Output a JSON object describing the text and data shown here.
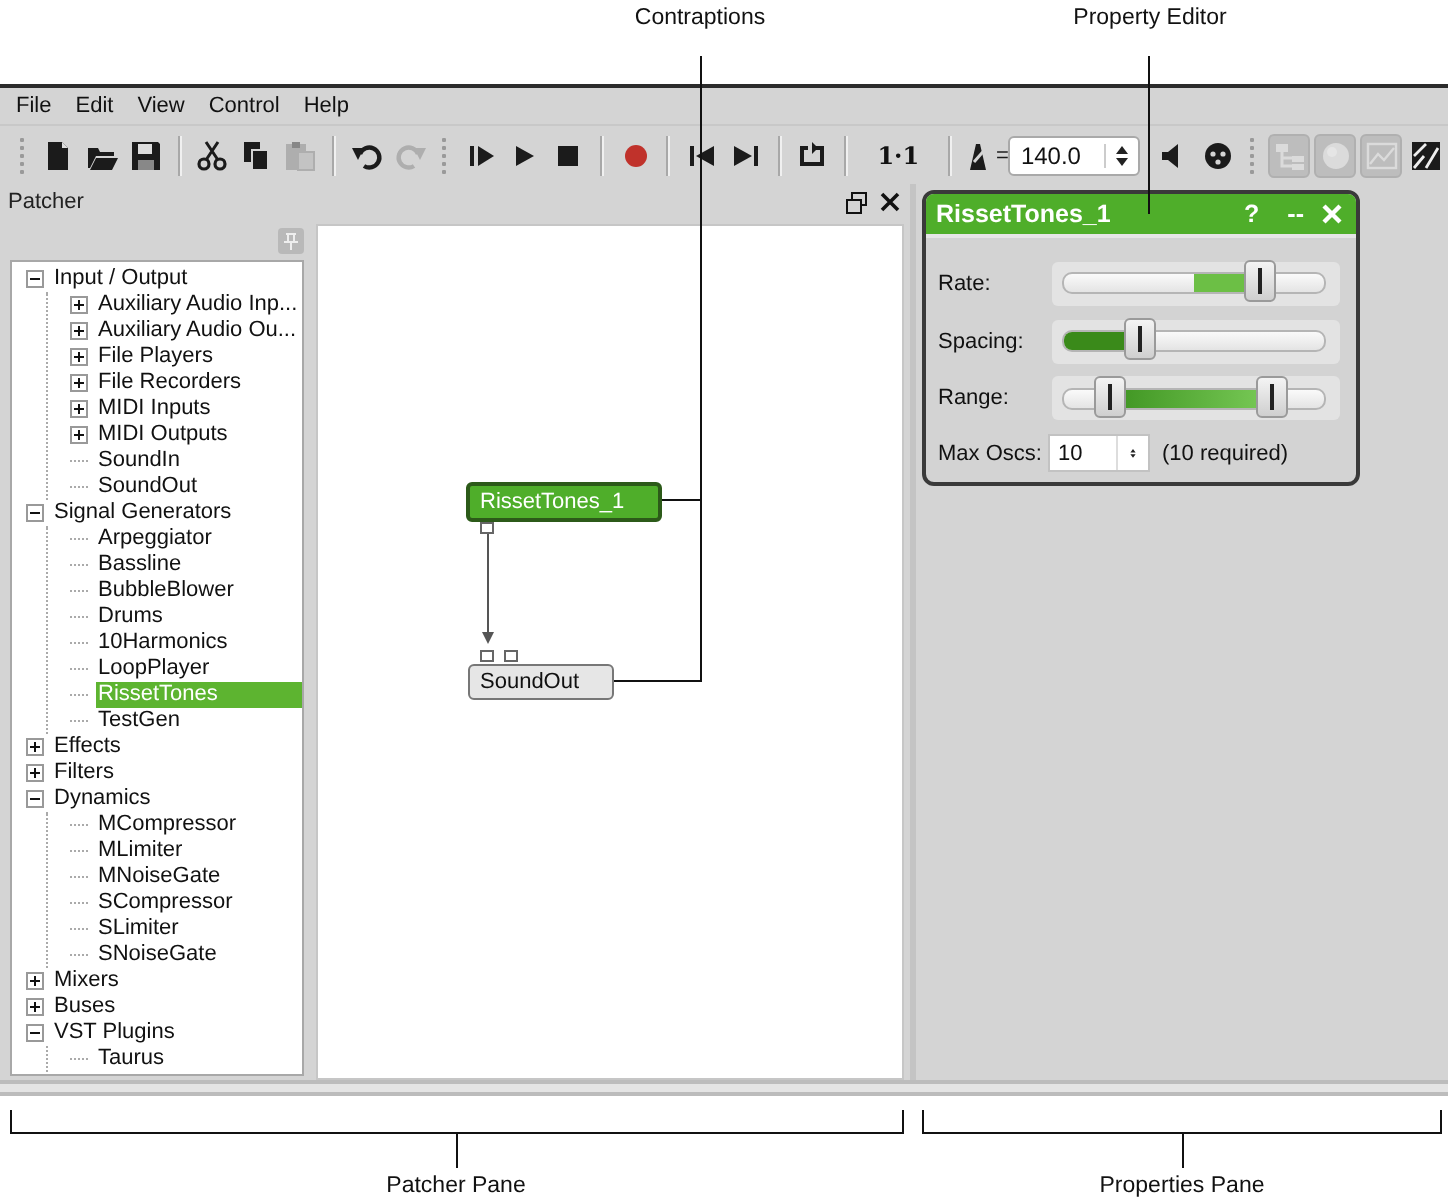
{
  "callouts": {
    "top": [
      {
        "label": "Contraptions"
      },
      {
        "label": "Property Editor"
      }
    ],
    "bottom": [
      {
        "label": "Patcher Pane"
      },
      {
        "label": "Properties Pane"
      }
    ]
  },
  "menu": [
    "File",
    "Edit",
    "View",
    "Control",
    "Help"
  ],
  "toolbar": [
    {
      "kind": "grip"
    },
    {
      "kind": "new-file",
      "disabled": false
    },
    {
      "kind": "open-folder",
      "disabled": false
    },
    {
      "kind": "save",
      "disabled": false
    },
    {
      "kind": "separator"
    },
    {
      "kind": "scissors",
      "disabled": false
    },
    {
      "kind": "copy",
      "disabled": false
    },
    {
      "kind": "paste",
      "disabled": true
    },
    {
      "kind": "separator"
    },
    {
      "kind": "undo",
      "disabled": false
    },
    {
      "kind": "redo",
      "disabled": true
    },
    {
      "kind": "grip"
    },
    {
      "kind": "step-play",
      "disabled": false
    },
    {
      "kind": "play",
      "disabled": false
    },
    {
      "kind": "stop",
      "disabled": false
    },
    {
      "kind": "separator"
    },
    {
      "kind": "record",
      "disabled": false
    },
    {
      "kind": "separator"
    },
    {
      "kind": "skip-back",
      "disabled": false
    },
    {
      "kind": "skip-forward",
      "disabled": false
    },
    {
      "kind": "separator"
    },
    {
      "kind": "loop",
      "disabled": false
    },
    {
      "kind": "separator"
    },
    {
      "kind": "position",
      "label": "1·1"
    },
    {
      "kind": "separator"
    },
    {
      "kind": "metronome",
      "label": "=",
      "disabled": false
    },
    {
      "kind": "tempo",
      "value": "140.0"
    },
    {
      "kind": "speaker",
      "disabled": false
    },
    {
      "kind": "dial",
      "disabled": false
    },
    {
      "kind": "grip"
    },
    {
      "kind": "tree",
      "disabled": true
    },
    {
      "kind": "circle",
      "disabled": true
    },
    {
      "kind": "graph",
      "disabled": true
    },
    {
      "kind": "layout",
      "disabled": false
    }
  ],
  "patcher": {
    "title": "Patcher",
    "tree": [
      {
        "label": "Input / Output",
        "expanded": true,
        "selected": false,
        "children": [
          {
            "label": "Auxiliary Audio Inp...",
            "expanded": false,
            "selected": false
          },
          {
            "label": "Auxiliary Audio Ou...",
            "expanded": false,
            "selected": false
          },
          {
            "label": "File Players",
            "expanded": false,
            "selected": false
          },
          {
            "label": "File Recorders",
            "expanded": false,
            "selected": false
          },
          {
            "label": "MIDI Inputs",
            "expanded": false,
            "selected": false
          },
          {
            "label": "MIDI Outputs",
            "expanded": false,
            "selected": false
          },
          {
            "label": "SoundIn",
            "selected": false
          },
          {
            "label": "SoundOut",
            "selected": false
          }
        ]
      },
      {
        "label": "Signal Generators",
        "expanded": true,
        "selected": false,
        "children": [
          {
            "label": "Arpeggiator",
            "selected": false
          },
          {
            "label": "Bassline",
            "selected": false
          },
          {
            "label": "BubbleBlower",
            "selected": false
          },
          {
            "label": "Drums",
            "selected": false
          },
          {
            "label": "10Harmonics",
            "selected": false
          },
          {
            "label": "LoopPlayer",
            "selected": false
          },
          {
            "label": "RissetTones",
            "selected": true
          },
          {
            "label": "TestGen",
            "selected": false
          }
        ]
      },
      {
        "label": "Effects",
        "expanded": false,
        "selected": false
      },
      {
        "label": "Filters",
        "expanded": false,
        "selected": false
      },
      {
        "label": "Dynamics",
        "expanded": true,
        "selected": false,
        "children": [
          {
            "label": "MCompressor",
            "selected": false
          },
          {
            "label": "MLimiter",
            "selected": false
          },
          {
            "label": "MNoiseGate",
            "selected": false
          },
          {
            "label": "SCompressor",
            "selected": false
          },
          {
            "label": "SLimiter",
            "selected": false
          },
          {
            "label": "SNoiseGate",
            "selected": false
          }
        ]
      },
      {
        "label": "Mixers",
        "expanded": false,
        "selected": false
      },
      {
        "label": "Buses",
        "expanded": false,
        "selected": false
      },
      {
        "label": "VST Plugins",
        "expanded": true,
        "selected": false,
        "children": [
          {
            "label": "Taurus",
            "selected": false
          }
        ]
      }
    ]
  },
  "canvas": {
    "nodes": [
      {
        "label": "RissetTones_1",
        "selected": true
      },
      {
        "label": "SoundOut",
        "selected": false
      }
    ]
  },
  "property_editor": {
    "title": "RissetTones_1",
    "help": "?",
    "minimize": "--",
    "rows": [
      {
        "kind": "bipolar_slider",
        "label": "Rate:",
        "level": 0.75
      },
      {
        "kind": "slider",
        "label": "Spacing:",
        "level": 0.29
      },
      {
        "kind": "range",
        "label": "Range:",
        "thumbs": [
          {
            "level": 0.18
          },
          {
            "level": 0.8
          }
        ]
      },
      {
        "kind": "spinbox",
        "label": "Max Oscs:",
        "value": "10",
        "note": "(10 required)"
      }
    ]
  }
}
